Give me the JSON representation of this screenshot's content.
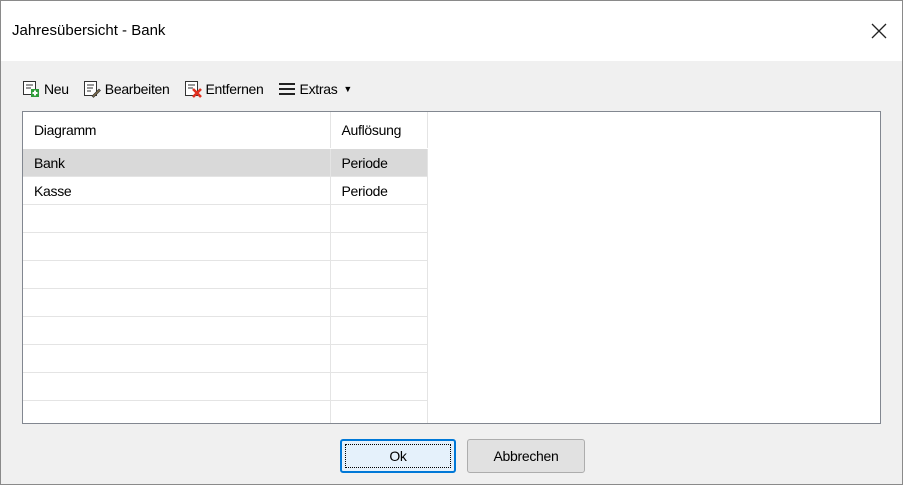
{
  "window": {
    "title": "Jahresübersicht - Bank",
    "close_icon": "close-icon"
  },
  "toolbar": {
    "new_label": "Neu",
    "edit_label": "Bearbeiten",
    "remove_label": "Entfernen",
    "extras_label": "Extras"
  },
  "grid": {
    "columns": [
      "Diagramm",
      "Auflösung"
    ],
    "rows": [
      {
        "diagramm": "Bank",
        "aufloesung": "Periode",
        "selected": true
      },
      {
        "diagramm": "Kasse",
        "aufloesung": "Periode",
        "selected": false
      }
    ]
  },
  "buttons": {
    "ok": "Ok",
    "cancel": "Abbrechen"
  },
  "colors": {
    "accent": "#0078d7",
    "selection": "#d9d9d9",
    "remove_x": "#e03020",
    "add_plus": "#2e9c3a"
  }
}
